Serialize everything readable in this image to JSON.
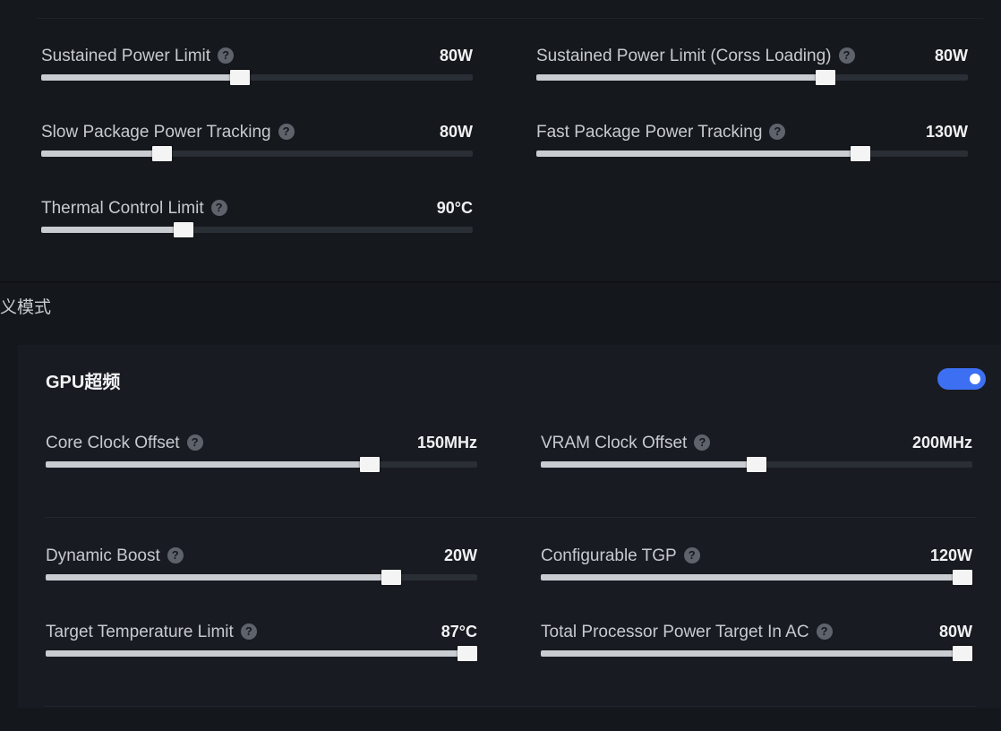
{
  "cpu": {
    "controls": [
      {
        "label": "Sustained Power Limit",
        "value": "80W",
        "fraction": 0.46
      },
      {
        "label": "Sustained Power Limit (Corss Loading)",
        "value": "80W",
        "fraction": 0.67
      },
      {
        "label": "Slow Package Power Tracking",
        "value": "80W",
        "fraction": 0.28
      },
      {
        "label": "Fast Package Power Tracking",
        "value": "130W",
        "fraction": 0.75
      },
      {
        "label": "Thermal Control Limit",
        "value": "90°C",
        "fraction": 0.33
      }
    ]
  },
  "section_title": "义模式",
  "gpu": {
    "title": "GPU超频",
    "toggle_on": true,
    "accent_color": "#3d6ff2",
    "controls": [
      {
        "label": "Core Clock Offset",
        "value": "150MHz",
        "fraction": 0.75
      },
      {
        "label": "VRAM Clock Offset",
        "value": "200MHz",
        "fraction": 0.5
      },
      {
        "label": "Dynamic Boost",
        "value": "20W",
        "fraction": 0.8
      },
      {
        "label": "Configurable TGP",
        "value": "120W",
        "fraction": 1.0
      },
      {
        "label": "Target Temperature Limit",
        "value": "87°C",
        "fraction": 1.0
      },
      {
        "label": "Total Processor Power Target In AC",
        "value": "80W",
        "fraction": 1.0
      }
    ]
  },
  "help_icon": "question-circle-icon"
}
